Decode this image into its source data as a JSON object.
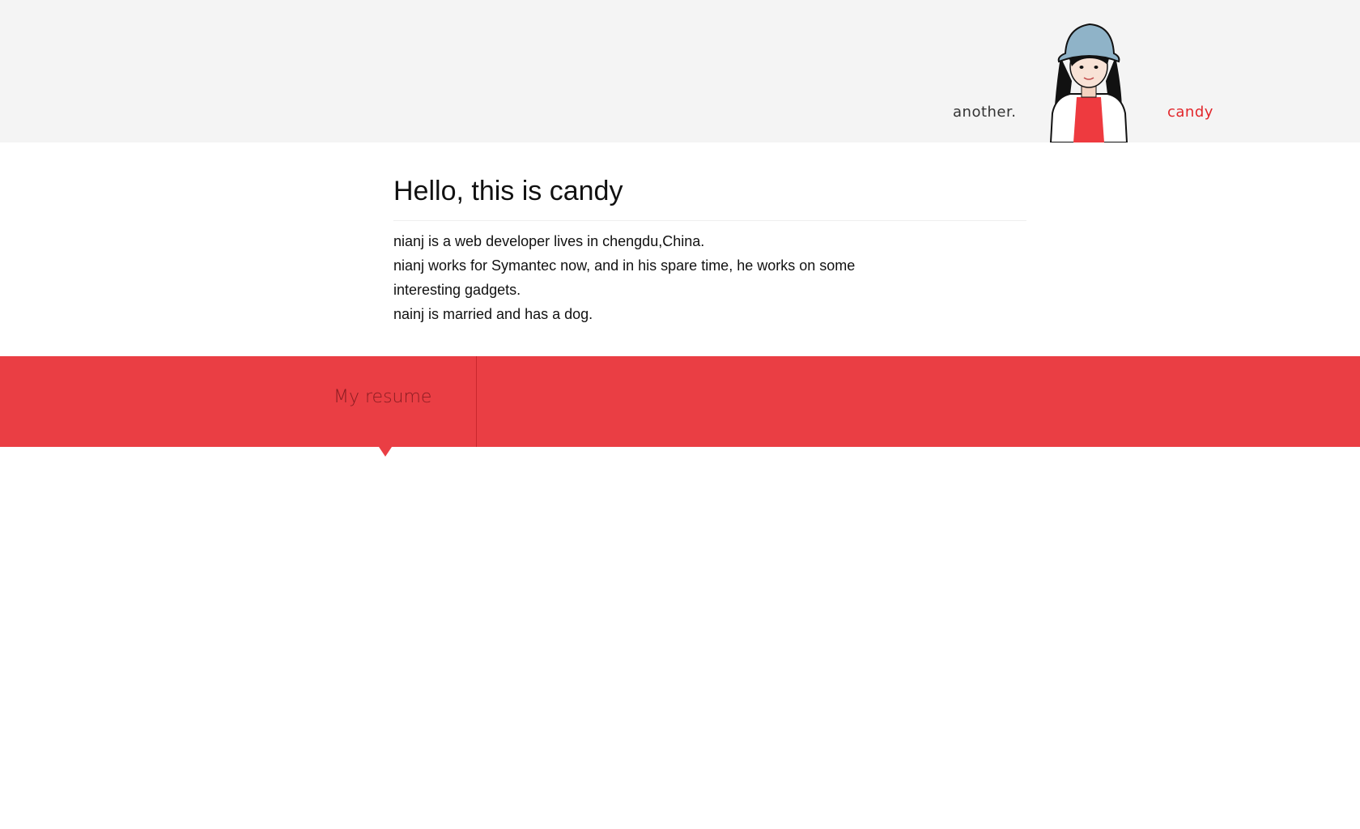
{
  "header": {
    "nav_left": "another.",
    "nav_right": "candy",
    "accent_color": "#e2262b",
    "avatar": "cartoon-girl-bucket-hat-avatar"
  },
  "intro": {
    "title": "Hello, this is candy",
    "lines": [
      "nianj is a web developer lives in chengdu,China.",
      "nianj works for Symantec now, and in his spare time, he works on some interesting gadgets.",
      "nainj is married and has a dog."
    ]
  },
  "band": {
    "color": "#ea3e44",
    "resume_label": "My resume"
  }
}
